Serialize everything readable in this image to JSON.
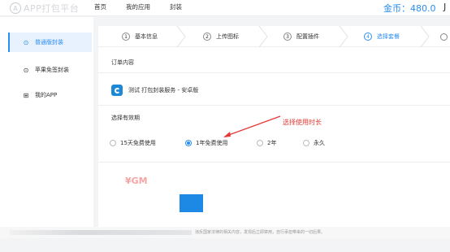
{
  "header": {
    "logo_mark": "A",
    "logo_text": "APP打包平台",
    "nav": [
      "首页",
      "我的应用",
      "封装"
    ],
    "coins_label": "金币：480.0",
    "coins_extra": "J"
  },
  "sidebar": {
    "items": [
      {
        "label": "普通版封装",
        "icon": "package-icon",
        "glyph": "⊙",
        "active": true
      },
      {
        "label": "苹果免签封装",
        "icon": "apple-icon",
        "glyph": "⊙",
        "active": false
      },
      {
        "label": "我的APP",
        "icon": "grid-icon",
        "glyph": "⊞",
        "active": false
      }
    ]
  },
  "steps": [
    {
      "num": "1",
      "label": "基本信息",
      "active": false
    },
    {
      "num": "2",
      "label": "上传图标",
      "active": false
    },
    {
      "num": "3",
      "label": "配置插件",
      "active": false
    },
    {
      "num": "4",
      "label": "选择套餐",
      "active": true
    }
  ],
  "order": {
    "section_title": "订单内容",
    "app_name": "测试 打包封装服务 - 安卓版"
  },
  "validity": {
    "section_title": "选择有效期",
    "annotation": "选择使用时长",
    "options": [
      {
        "label": "15天免费使用",
        "selected": false
      },
      {
        "label": "1年免费使用",
        "selected": true
      },
      {
        "label": "2年",
        "selected": false
      },
      {
        "label": "永久",
        "selected": false
      }
    ]
  },
  "price_fragment": "¥GM",
  "footer_text": "违反国家法律的相关内容，发现后立即禁用，自行承担带来的一切后果。",
  "colors": {
    "accent": "#2c8df0",
    "annotation": "#e53935"
  }
}
